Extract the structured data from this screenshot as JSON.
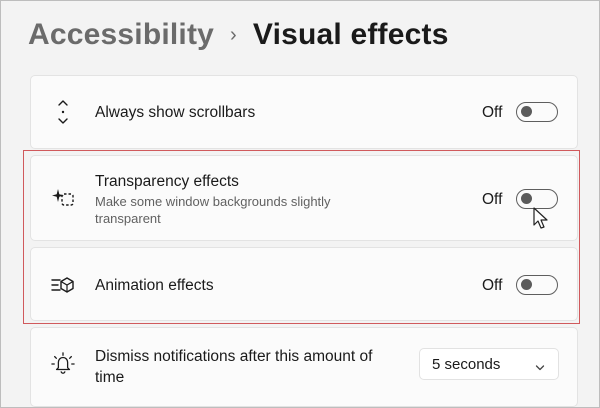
{
  "breadcrumb": {
    "parent": "Accessibility",
    "separator": "›",
    "current": "Visual effects"
  },
  "settings": [
    {
      "label": "Always show scrollbars",
      "description": "",
      "state": "Off",
      "icon": "scrollbar-arrows-icon",
      "toggle_on": false
    },
    {
      "label": "Transparency effects",
      "description": "Make some window backgrounds slightly transparent",
      "state": "Off",
      "icon": "transparency-sparkle-icon",
      "toggle_on": false
    },
    {
      "label": "Animation effects",
      "description": "",
      "state": "Off",
      "icon": "animation-effects-icon",
      "toggle_on": false
    },
    {
      "label": "Dismiss notifications after this amount of time",
      "description": "",
      "icon": "notification-bell-icon",
      "dropdown_value": "5 seconds"
    }
  ],
  "colors": {
    "highlight_border": "#d0595c",
    "card_background": "#fbfbfb",
    "page_background": "#f3f3f3"
  }
}
